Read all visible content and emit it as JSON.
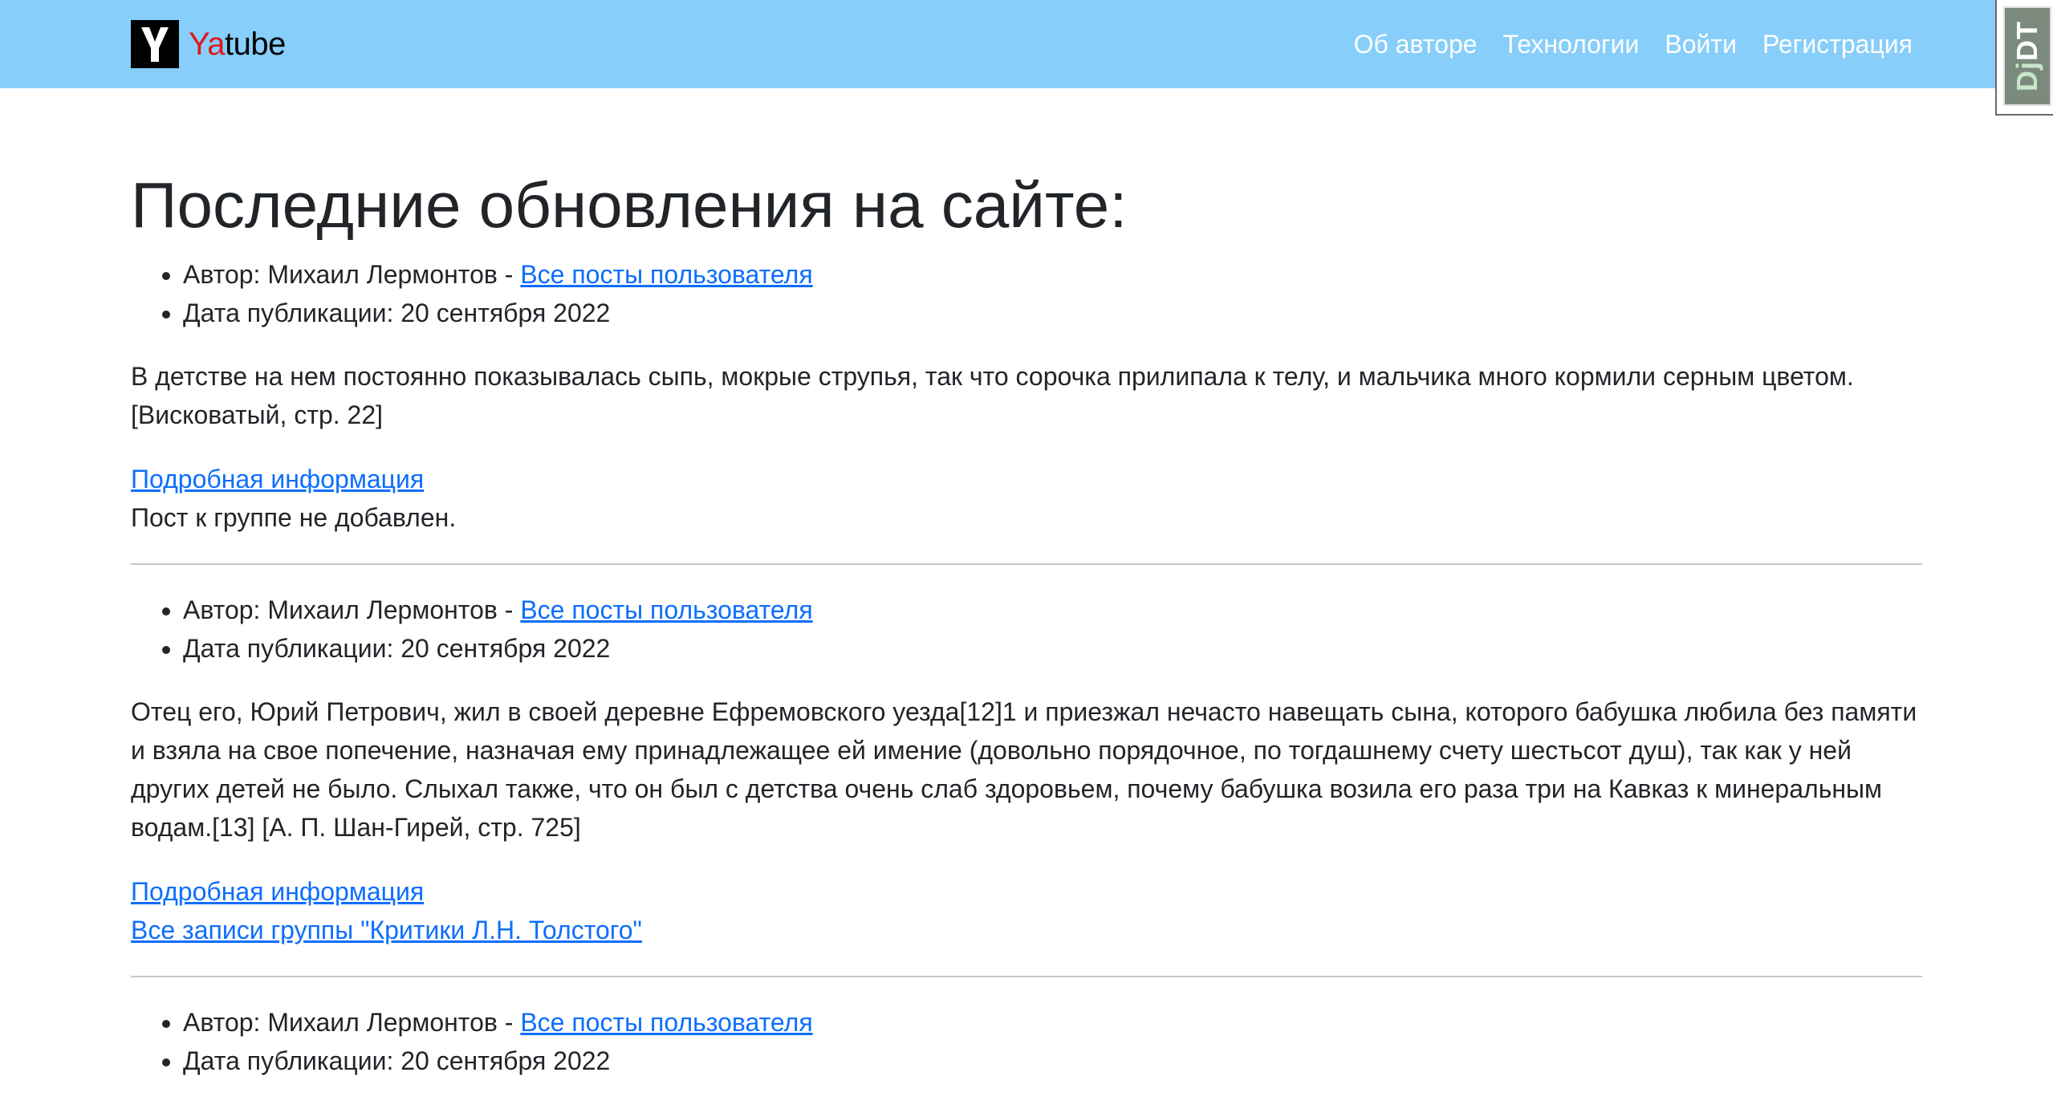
{
  "navbar": {
    "brand_ya": "Ya",
    "brand_tube": "tube",
    "links": [
      "Об авторе",
      "Технологии",
      "Войти",
      "Регистрация"
    ]
  },
  "debug_toolbar": {
    "label_dj": "Dj",
    "label_dt": "DT"
  },
  "page_title": "Последние обновления на сайте:",
  "posts": [
    {
      "author": "Автор: Михаил Лермонтов - ",
      "author_link": "Все посты пользователя",
      "date": "Дата публикации: 20 сентября 2022",
      "text": "В детстве на нем постоянно показывалась сыпь, мокрые струпья, так что сорочка прилипала к телу, и мальчика много кормили серным цветом. [Висковатый, стр. 22]",
      "details_link": "Подробная информация",
      "group_status": "Пост к группе не добавлен."
    },
    {
      "author": "Автор: Михаил Лермонтов - ",
      "author_link": "Все посты пользователя",
      "date": "Дата публикации: 20 сентября 2022",
      "text": "Отец его, Юрий Петрович, жил в своей деревне Ефремовского уезда[12]1 и приезжал нечасто навещать сына, которого бабушка любила без памяти и взяла на свое попечение, назначая ему принадлежащее ей имение (довольно порядочное, по тогдашнему счету шестьсот душ), так как у ней других детей не было. Слыхал также, что он был с детства очень слаб здоровьем, почему бабушка возила его раза три на Кавказ к минеральным водам.[13] [А. П. Шан-Гирей, стр. 725]",
      "details_link": "Подробная информация",
      "group_link": "Все записи группы \"Критики Л.Н. Толстого\""
    },
    {
      "author": "Автор: Михаил Лермонтов - ",
      "author_link": "Все посты пользователя",
      "date": "Дата публикации: 20 сентября 2022"
    }
  ]
}
